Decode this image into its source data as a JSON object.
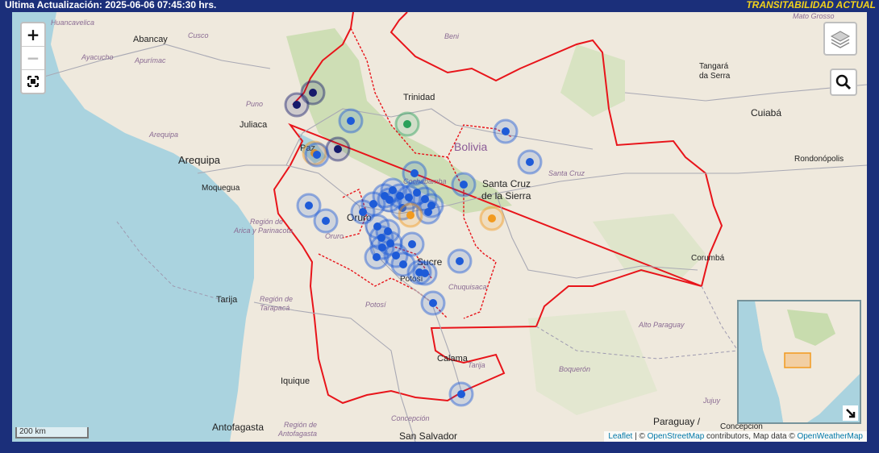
{
  "header": {
    "updated": "Ultima Actualización: 2025-06-06 07:45:30 hrs.",
    "status_title": "TRANSITABILIDAD ACTUAL"
  },
  "controls": {
    "zoom_in": "+",
    "zoom_out": "−",
    "fullscreen_icon": "fullscreen-icon",
    "layers_icon": "layers-icon",
    "search_icon": "search-icon",
    "minimap_toggle_icon": "arrow-down-right-icon"
  },
  "scale": {
    "label": "200 km"
  },
  "attribution": {
    "leaflet": "Leaflet",
    "osm": "OpenStreetMap",
    "mid": " contributors, Map data © ",
    "owm": "OpenWeatherMap",
    "sep": " | © "
  },
  "labels": {
    "cities": [
      {
        "id": "abancay",
        "text": "Abancay"
      },
      {
        "id": "cusco",
        "text": "Cusco"
      },
      {
        "id": "juliaca",
        "text": "Juliaca"
      },
      {
        "id": "puno",
        "text": "Puno"
      },
      {
        "id": "arequipa",
        "text": "Arequipa"
      },
      {
        "id": "moquegua",
        "text": "Moquegua"
      },
      {
        "id": "trinidad",
        "text": "Trinidad"
      },
      {
        "id": "santacruz1",
        "text": "Santa Cruz"
      },
      {
        "id": "santacruz2",
        "text": "de la Sierra"
      },
      {
        "id": "oruro",
        "text": "Oruro"
      },
      {
        "id": "sucre",
        "text": "Sucre"
      },
      {
        "id": "potosi",
        "text": "Potosí"
      },
      {
        "id": "tarija",
        "text": "Tarija"
      },
      {
        "id": "iquique",
        "text": "Iquique"
      },
      {
        "id": "calama",
        "text": "Calama"
      },
      {
        "id": "antofagasta",
        "text": "Antofagasta"
      },
      {
        "id": "sansalvador",
        "text": "San Salvador"
      },
      {
        "id": "tangara",
        "text": "Tangará"
      },
      {
        "id": "daserra",
        "text": "da Serra"
      },
      {
        "id": "cuiaba",
        "text": "Cuiabá"
      },
      {
        "id": "rondonopolis",
        "text": "Rondonópolis"
      },
      {
        "id": "corumba",
        "text": "Corumbá"
      },
      {
        "id": "paraguay",
        "text": "Paraguay /"
      },
      {
        "id": "concepcion",
        "text": "Concepción"
      },
      {
        "id": "paz",
        "text": "Paz"
      }
    ],
    "regions": [
      {
        "id": "huancavelica",
        "text": "Huancavelica"
      },
      {
        "id": "ayacucho",
        "text": "Ayacucho"
      },
      {
        "id": "apurimac",
        "text": "Apurímac"
      },
      {
        "id": "cusco_r",
        "text": "Cusco"
      },
      {
        "id": "arequipa_r",
        "text": "Arequipa"
      },
      {
        "id": "beni",
        "text": "Beni"
      },
      {
        "id": "matogrosso",
        "text": "Mato Grosso"
      },
      {
        "id": "santacruz_r",
        "text": "Santa Cruz"
      },
      {
        "id": "cochabamba",
        "text": "Cochabamba"
      },
      {
        "id": "oruro_r",
        "text": "Oruro"
      },
      {
        "id": "arica1",
        "text": "Región de"
      },
      {
        "id": "arica2",
        "text": "Arica y Parinacota"
      },
      {
        "id": "tarapaca1",
        "text": "Región de"
      },
      {
        "id": "tarapaca2",
        "text": "Tarapacá"
      },
      {
        "id": "potosi_r",
        "text": "Potosí"
      },
      {
        "id": "chuquisaca",
        "text": "Chuquisaca"
      },
      {
        "id": "tarija_r",
        "text": "Tarija"
      },
      {
        "id": "altoparaguay",
        "text": "Alto Paraguay"
      },
      {
        "id": "boqueron",
        "text": "Boquerón"
      },
      {
        "id": "antof1",
        "text": "Región de"
      },
      {
        "id": "antof2",
        "text": "Antofagasta"
      },
      {
        "id": "jujuy",
        "text": "Jujuy"
      },
      {
        "id": "concepcion_r",
        "text": "Concepción"
      }
    ],
    "country": {
      "text": "Bolivia"
    }
  },
  "colors": {
    "border": "#e8141a",
    "sea": "#aad3df",
    "land": "#efe9dd",
    "forest": "#c8dcae",
    "marker_blue": "#1e5bd8",
    "marker_orange": "#f29a1e",
    "marker_green": "#2aa05a",
    "marker_navy": "#161a6b"
  }
}
